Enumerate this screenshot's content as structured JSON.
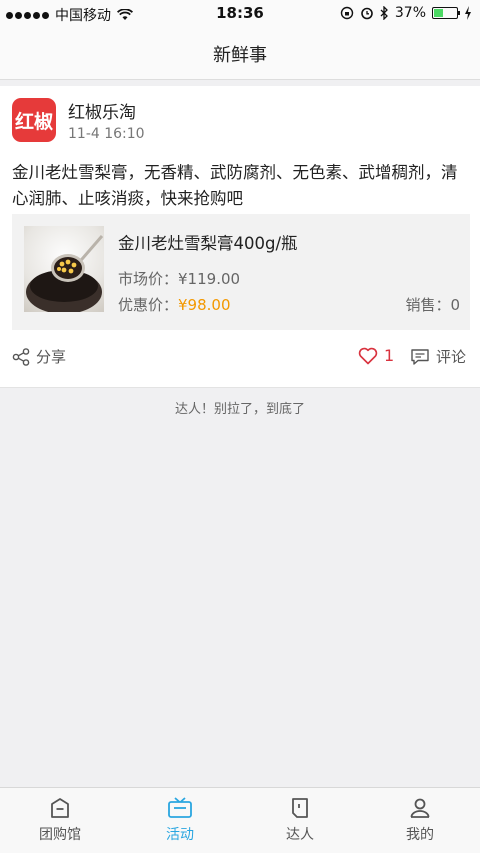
{
  "status_bar": {
    "carrier": "中国移动",
    "time": "18:36",
    "battery": "37%",
    "battery_level": 0.37
  },
  "nav": {
    "title": "新鲜事"
  },
  "post": {
    "shop_name": "红椒乐淘",
    "avatar_text": "红椒",
    "time": "11-4 16:10",
    "text": "金川老灶雪梨膏，无香精、武防腐剂、无色素、武增稠剂，清心润肺、止咳消痰，快来抢购吧",
    "product": {
      "title": "金川老灶雪梨膏400g/瓶",
      "market_price_label": "市场价：",
      "market_price": "¥119.00",
      "sale_price_label": "优惠价：",
      "sale_price": "¥98.00",
      "sales_label": "销售：",
      "sales": "0"
    },
    "actions": {
      "share_label": "分享",
      "like_count": "1",
      "comment_label": "评论"
    }
  },
  "end_text": "达人！别拉了，到底了",
  "tabs": [
    {
      "label": "团购馆",
      "icon": "shop-icon"
    },
    {
      "label": "活动",
      "icon": "tv-icon"
    },
    {
      "label": "达人",
      "icon": "person-card-icon"
    },
    {
      "label": "我的",
      "icon": "user-icon"
    }
  ],
  "colors": {
    "accent": "#2aa6e0",
    "price": "#f39800",
    "like": "#d9333f",
    "avatar_bg": "#e63a3a"
  }
}
